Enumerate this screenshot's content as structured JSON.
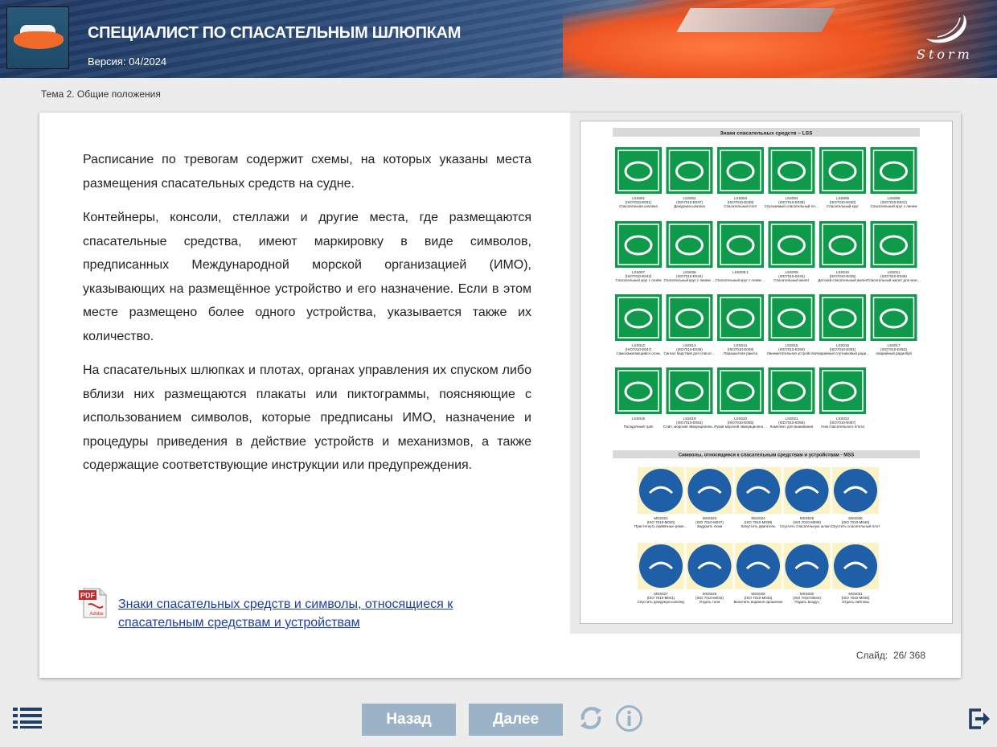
{
  "header": {
    "title": "СПЕЦИАЛИСТ ПО СПАСАТЕЛЬНЫМ ШЛЮПКАМ",
    "version": "Версия: 04/2024",
    "logo_text": "Storm"
  },
  "breadcrumb": "Тема 2. Общие положения",
  "content": {
    "paragraphs": [
      "Расписание по тревогам содержит схемы, на которых указаны места размещения спасательных средств на судне.",
      "Контейнеры, консоли, стеллажи и другие места, где размещаются спасательные средства, имеют маркировку в виде символов, предписанных Международной морской организацией (ИМО), указывающих на размещённое устройство и его назначение. Если в этом месте размещено более одного устройства, указывается также их количество.",
      "На спасательных шлюпках и плотах, органах управления их спуском либо вблизи них размещаются плакаты или пиктограммы, поясняющие с использованием символов, которые предписаны ИМО, назначение и процедуры приведения в действие устройств и механизмов, а также содержащие соответствующие инструкции или предупреждения."
    ],
    "pdf_label": "PDF",
    "pdf_sub": "Adobe",
    "pdf_link": "Знаки спасательных средств и символы, относящиеся к спасательным средствам и устройствам"
  },
  "sheet": {
    "lss_title": "Знаки спасательных средств – LSS",
    "mss_title": "Символы, относящиеся к спасательным средствам и устройствам - MSS",
    "lss_rows": [
      [
        {
          "code": "LSS001",
          "iso": "(ISO7010-E031)",
          "name": "Спасательная шлюпка"
        },
        {
          "code": "LSS002",
          "iso": "(ISO7010-E037)",
          "name": "Дежурная шлюпка"
        },
        {
          "code": "LSS003",
          "iso": "(ISO7010-E038)",
          "name": "Спасательный плот"
        },
        {
          "code": "LSS004",
          "iso": "(ISO7010-E039)",
          "name": "Спускаемый спасательный плот"
        },
        {
          "code": "LSS005",
          "iso": "(ISO7010-E040)",
          "name": "Спасательный круг"
        },
        {
          "code": "LSS006",
          "iso": "(ISO7010-E041)",
          "name": "Спасательный круг с линем"
        }
      ],
      [
        {
          "code": "LSS007",
          "iso": "(ISO7010-E042)",
          "name": "Спасательный круг с огнём"
        },
        {
          "code": "LSS008",
          "iso": "(ISO7010-E043)",
          "name": "Спасательный круг с линем и огнём"
        },
        {
          "code": "LSS008.1",
          "iso": "",
          "name": "Спасательный круг с огнём и дымовой шашкой"
        },
        {
          "code": "LSS009",
          "iso": "(ISO7010-E044)",
          "name": "Спасательный жилет"
        },
        {
          "code": "LSS010",
          "iso": "(ISO7010-E045)",
          "name": "Детский спасательный жилет"
        },
        {
          "code": "LSS011",
          "iso": "(ISO7010-E046)",
          "name": "Спасательный жилет для младенца"
        }
      ],
      [
        {
          "code": "LSS012",
          "iso": "(ISO7010-E047)",
          "name": "Самозажигающийся огонь"
        },
        {
          "code": "LSS013",
          "iso": "(ISO7010-E048)",
          "name": "Сигнал бедствия для спасательных средств"
        },
        {
          "code": "LSS014",
          "iso": "(ISO7010-E049)",
          "name": "Парашютная ракета"
        },
        {
          "code": "LSS015",
          "iso": "(ISO7010-E050)",
          "name": "Линеметательное устройство"
        },
        {
          "code": "LSS016",
          "iso": "(ISO7010-E051)",
          "name": "Аварийный спутниковый радиобуй УКВ-связи"
        },
        {
          "code": "LSS017",
          "iso": "(ISO7010-E052)",
          "name": "Аварийный радиобуй"
        }
      ],
      [
        {
          "code": "LSS018",
          "iso": "",
          "name": "Посадочный трап"
        },
        {
          "code": "LSS019",
          "iso": "(ISO7010-E054)",
          "name": "Слип, морская эвакуационная система"
        },
        {
          "code": "LSS020",
          "iso": "(ISO7010-E055)",
          "name": "Рукав морской эвакуационной системы"
        },
        {
          "code": "LSS021",
          "iso": "(ISO7010-E056)",
          "name": "Комплект для выживания"
        },
        {
          "code": "LSS022",
          "iso": "(ISO7010-E057)",
          "name": "Нож спасательного плота"
        }
      ]
    ],
    "mss_rows": [
      [
        {
          "code": "MSS022",
          "iso": "(ISO 7010-M020)",
          "name": "Пристегнуть привязные ремни"
        },
        {
          "code": "MSS023",
          "iso": "(ISO 7010-M037)",
          "name": "Задраить люки"
        },
        {
          "code": "MSS024",
          "iso": "(ISO 7010-M038)",
          "name": "Запустить двигатель"
        },
        {
          "code": "MSS025",
          "iso": "(ISO 7010-M039)",
          "name": "Спустить спасательную шлюпку"
        },
        {
          "code": "MSS026",
          "iso": "(ISO 7010-M040)",
          "name": "Спустить спасательный плот"
        }
      ],
      [
        {
          "code": "MSS027",
          "iso": "(ISO 7010-M041)",
          "name": "Спустить дежурную шлюпку"
        },
        {
          "code": "MSS028",
          "iso": "(ISO 7010-M042)",
          "name": "Отдать тали"
        },
        {
          "code": "MSS029",
          "iso": "(ISO 7010-M043)",
          "name": "Включить водяное орошение"
        },
        {
          "code": "MSS030",
          "iso": "(ISO 7010-M044)",
          "name": "Подать воздух"
        },
        {
          "code": "MSS031",
          "iso": "(ISO 7010-M045)",
          "name": "Отдать найтовы"
        }
      ]
    ]
  },
  "slide": {
    "label": "Слайд:",
    "current": "26",
    "total": "368"
  },
  "nav": {
    "back_label": "Назад",
    "next_label": "Далее",
    "menu_icon": "menu-list-icon",
    "refresh_icon": "refresh-icon",
    "info_icon": "info-icon",
    "exit_icon": "exit-icon"
  },
  "colors": {
    "accent_button": "#9cb3c7",
    "lss_green": "#0e9a4a",
    "mss_blue": "#1e5fa8",
    "link": "#1b3fa8"
  }
}
